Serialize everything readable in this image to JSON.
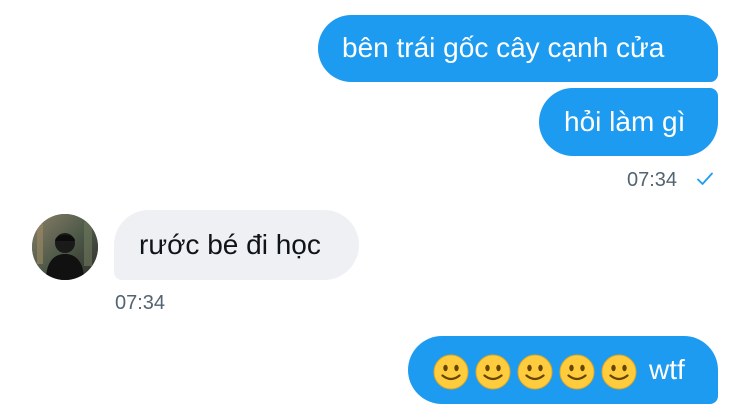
{
  "conversation": {
    "messages": [
      {
        "sender": "me",
        "text": "bên trái gốc cây cạnh cửa"
      },
      {
        "sender": "me",
        "text": "hỏi làm gì"
      },
      {
        "sender": "other",
        "text": "rước bé đi học"
      },
      {
        "sender": "me",
        "text": "wtf",
        "emojis": [
          "slightly-smiling-face",
          "slightly-smiling-face",
          "slightly-smiling-face",
          "slightly-smiling-face",
          "slightly-smiling-face"
        ]
      }
    ],
    "sent_time": "07:34",
    "received_time": "07:34",
    "read_status_icon": "checkmark-icon"
  },
  "colors": {
    "sent_bubble": "#1d9bf0",
    "received_bubble": "#eef0f4",
    "timestamp": "#536471",
    "emoji_face": "#ffcc3e"
  }
}
